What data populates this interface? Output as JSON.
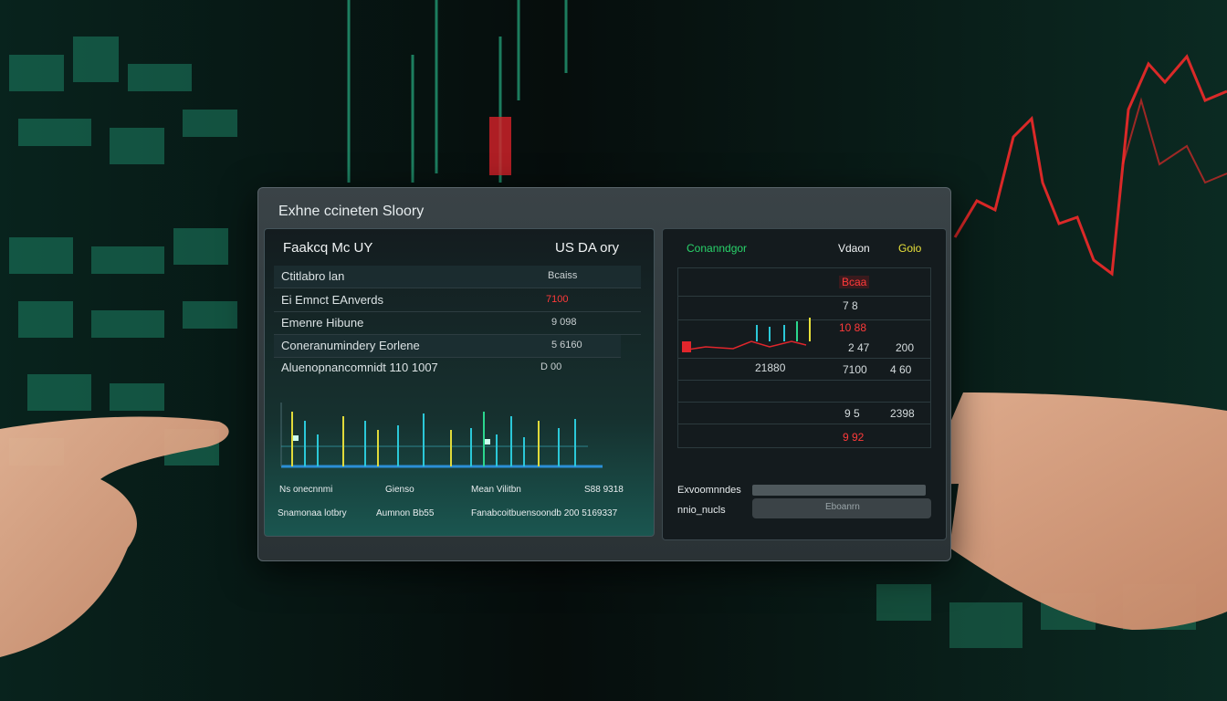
{
  "panel": {
    "title": "Exhne ccineten Sloory"
  },
  "left": {
    "header_left": "Faakcq Mc UY",
    "header_right": "US DA ory",
    "rows": [
      {
        "label": "Ctitlabro lan",
        "value": "Bcaiss"
      },
      {
        "label": "Ei Emnct EAnverds",
        "value": "7100"
      },
      {
        "label": "Emenre Hibune",
        "value": "9 098"
      },
      {
        "label": "Coneranumindery Eorlene",
        "value": "5 6160"
      },
      {
        "label": "Aluenopnancomnidt 110 1007",
        "value": "D 00"
      }
    ],
    "footer_row1": [
      "Ns onecnnmi",
      "Gienso",
      "Mean Vilitbn",
      "S88 9318"
    ],
    "footer_row2": [
      "Snamonaa lotbry",
      "Aumnon Bb55",
      "Fanabcoitbuensoondb 200 5169337"
    ]
  },
  "right": {
    "header_green": "Conanndgor",
    "header_white": "Vdaon",
    "header_yellow": "Goio",
    "values": {
      "top_red": "Bcaa",
      "row2": "7 8",
      "red_mid": "10 88",
      "r3a": "2 47",
      "r3b": "200",
      "r4a": "21880",
      "r4b": "7100",
      "r4c": "4 60",
      "r5a": "9 5",
      "r5b": "2398",
      "r6_red": "9 92"
    },
    "footer_label1": "Exvoomnndes",
    "footer_label2": "nnio_nucls",
    "footer_btn_text": "Eboanrn"
  },
  "colors": {
    "accent_green": "#29d36a",
    "accent_red": "#e0262c",
    "accent_yellow": "#e8e03a",
    "cyan": "#2bc8d8"
  }
}
